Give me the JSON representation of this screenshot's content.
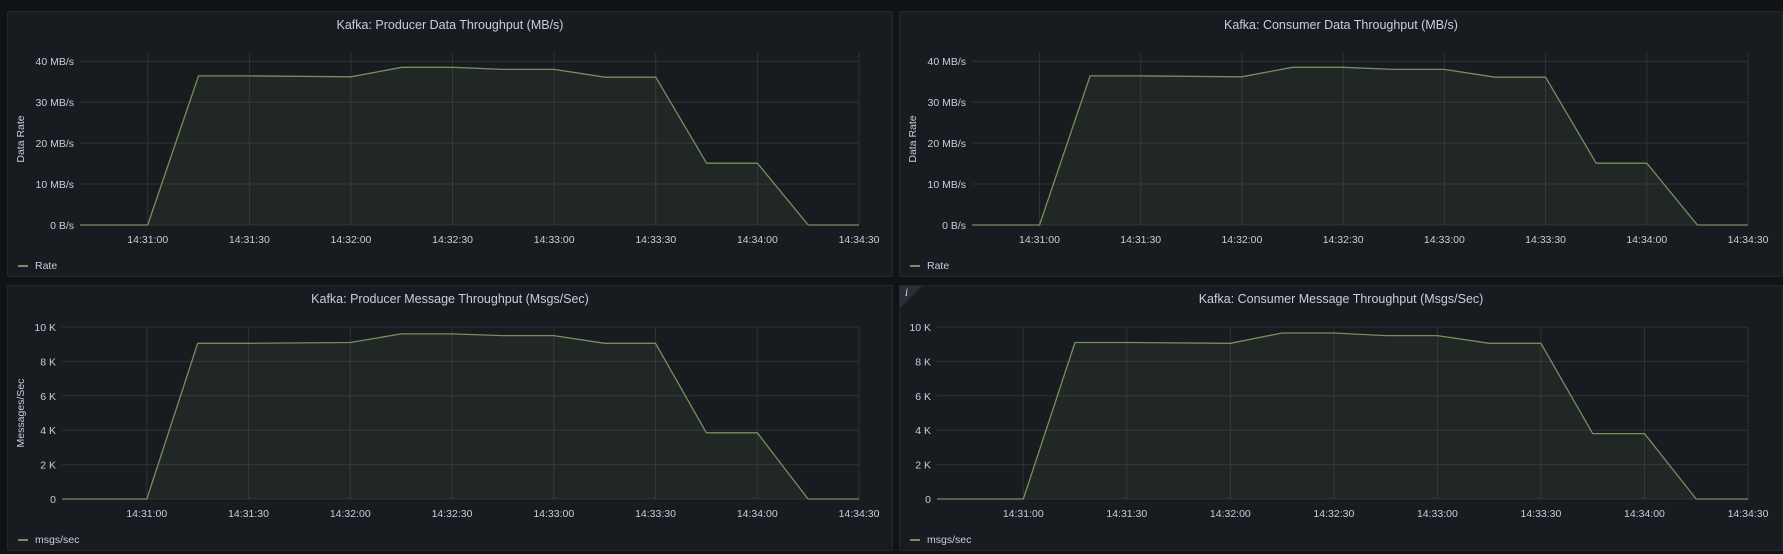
{
  "theme": {
    "background": "#111217",
    "panel_background": "#181b1f",
    "grid_color": "#2f3237",
    "series_line_color": "#73905f",
    "series_fill_color": "#73905f"
  },
  "panels": [
    {
      "title": "Kafka: Producer Data Throughput (MB/s)",
      "ylabel": "Data Rate",
      "legend": "Rate",
      "info_icon": "",
      "chart_data": {
        "type": "area",
        "title": "Kafka: Producer Data Throughput (MB/s)",
        "ylabel": "Data Rate",
        "ylim": [
          0,
          42
        ],
        "xlim": [
          "14:30:40",
          "14:34:30"
        ],
        "y_ticks": [
          0,
          10,
          20,
          30,
          40
        ],
        "y_tick_labels": [
          "0 B/s",
          "10 MB/s",
          "20 MB/s",
          "30 MB/s",
          "40 MB/s"
        ],
        "x_tick_labels": [
          "14:31:00",
          "14:31:30",
          "14:32:00",
          "14:32:30",
          "14:33:00",
          "14:33:30",
          "14:34:00",
          "14:34:30"
        ],
        "grid": true,
        "legend_position": "bottom-left",
        "series": [
          {
            "name": "Rate",
            "x": [
              "14:30:40",
              "14:31:00",
              "14:31:15",
              "14:31:30",
              "14:32:00",
              "14:32:15",
              "14:32:30",
              "14:32:45",
              "14:33:00",
              "14:33:15",
              "14:33:30",
              "14:33:45",
              "14:34:00",
              "14:34:15",
              "14:34:30"
            ],
            "values": [
              0,
              0,
              36.4,
              36.4,
              36.2,
              38.5,
              38.5,
              38.0,
              38.0,
              36.1,
              36.1,
              15.1,
              15.1,
              0,
              0
            ]
          }
        ]
      }
    },
    {
      "title": "Kafka: Consumer Data Throughput (MB/s)",
      "ylabel": "Data Rate",
      "legend": "Rate",
      "info_icon": "",
      "chart_data": {
        "type": "area",
        "title": "Kafka: Consumer Data Throughput (MB/s)",
        "ylabel": "Data Rate",
        "ylim": [
          0,
          42
        ],
        "xlim": [
          "14:30:40",
          "14:34:30"
        ],
        "y_ticks": [
          0,
          10,
          20,
          30,
          40
        ],
        "y_tick_labels": [
          "0 B/s",
          "10 MB/s",
          "20 MB/s",
          "30 MB/s",
          "40 MB/s"
        ],
        "x_tick_labels": [
          "14:31:00",
          "14:31:30",
          "14:32:00",
          "14:32:30",
          "14:33:00",
          "14:33:30",
          "14:34:00",
          "14:34:30"
        ],
        "grid": true,
        "legend_position": "bottom-left",
        "series": [
          {
            "name": "Rate",
            "x": [
              "14:30:40",
              "14:31:00",
              "14:31:15",
              "14:31:30",
              "14:32:00",
              "14:32:15",
              "14:32:30",
              "14:32:45",
              "14:33:00",
              "14:33:15",
              "14:33:30",
              "14:33:45",
              "14:34:00",
              "14:34:15",
              "14:34:30"
            ],
            "values": [
              0,
              0,
              36.4,
              36.4,
              36.2,
              38.5,
              38.5,
              38.0,
              38.0,
              36.1,
              36.1,
              15.1,
              15.1,
              0,
              0
            ]
          }
        ]
      }
    },
    {
      "title": "Kafka: Producer Message Throughput (Msgs/Sec)",
      "ylabel": "Messages/Sec",
      "legend": "msgs/sec",
      "info_icon": "",
      "chart_data": {
        "type": "area",
        "title": "Kafka: Producer Message Throughput (Msgs/Sec)",
        "ylabel": "Messages/Sec",
        "ylim": [
          0,
          10000
        ],
        "xlim": [
          "14:30:35",
          "14:34:30"
        ],
        "y_ticks": [
          0,
          2000,
          4000,
          6000,
          8000,
          10000
        ],
        "y_tick_labels": [
          "0",
          "2 K",
          "4 K",
          "6 K",
          "8 K",
          "10 K"
        ],
        "x_tick_labels": [
          "14:31:00",
          "14:31:30",
          "14:32:00",
          "14:32:30",
          "14:33:00",
          "14:33:30",
          "14:34:00",
          "14:34:30"
        ],
        "grid": true,
        "legend_position": "bottom-left",
        "series": [
          {
            "name": "msgs/sec",
            "x": [
              "14:30:35",
              "14:31:00",
              "14:31:15",
              "14:31:30",
              "14:32:00",
              "14:32:15",
              "14:32:30",
              "14:32:45",
              "14:33:00",
              "14:33:15",
              "14:33:30",
              "14:33:45",
              "14:34:00",
              "14:34:15",
              "14:34:30"
            ],
            "values": [
              0,
              0,
              9050,
              9050,
              9100,
              9600,
              9600,
              9500,
              9500,
              9050,
              9050,
              3850,
              3850,
              0,
              0
            ]
          }
        ]
      }
    },
    {
      "title": "Kafka: Consumer Message Throughput (Msgs/Sec)",
      "ylabel": "",
      "legend": "msgs/sec",
      "info_icon": "i",
      "chart_data": {
        "type": "area",
        "title": "Kafka: Consumer Message Throughput (Msgs/Sec)",
        "ylabel": "",
        "ylim": [
          0,
          10000
        ],
        "xlim": [
          "14:30:35",
          "14:34:30"
        ],
        "y_ticks": [
          0,
          2000,
          4000,
          6000,
          8000,
          10000
        ],
        "y_tick_labels": [
          "0",
          "2 K",
          "4 K",
          "6 K",
          "8 K",
          "10 K"
        ],
        "x_tick_labels": [
          "14:31:00",
          "14:31:30",
          "14:32:00",
          "14:32:30",
          "14:33:00",
          "14:33:30",
          "14:34:00",
          "14:34:30"
        ],
        "grid": true,
        "legend_position": "bottom-left",
        "series": [
          {
            "name": "msgs/sec",
            "x": [
              "14:30:35",
              "14:31:00",
              "14:31:15",
              "14:31:30",
              "14:32:00",
              "14:32:15",
              "14:32:30",
              "14:32:45",
              "14:33:00",
              "14:33:15",
              "14:33:30",
              "14:33:45",
              "14:34:00",
              "14:34:15",
              "14:34:30"
            ],
            "values": [
              0,
              0,
              9100,
              9100,
              9050,
              9650,
              9650,
              9500,
              9500,
              9050,
              9050,
              3800,
              3800,
              0,
              0
            ]
          }
        ]
      }
    }
  ]
}
